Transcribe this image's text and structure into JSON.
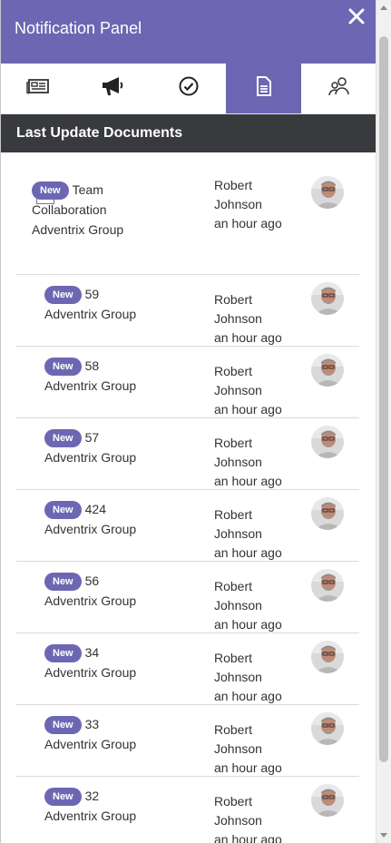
{
  "header": {
    "title": "Notification Panel",
    "close_icon": "close-icon"
  },
  "tabs": [
    {
      "name": "news",
      "icon": "newspaper-icon",
      "active": false
    },
    {
      "name": "announcements",
      "icon": "megaphone-icon",
      "active": false
    },
    {
      "name": "tasks",
      "icon": "checkmark-circle-icon",
      "active": false
    },
    {
      "name": "documents",
      "icon": "document-icon",
      "active": true
    },
    {
      "name": "people",
      "icon": "users-icon",
      "active": false
    }
  ],
  "section": {
    "title": "Last Update Documents"
  },
  "colors": {
    "accent": "#6c67b3",
    "section_bar": "#383a3d"
  },
  "items": [
    {
      "badge": "New",
      "title": "Team Collaboration",
      "group": "Adventrix Group",
      "author_first": "Robert",
      "author_last": "Johnson",
      "time": "an hour ago"
    },
    {
      "badge": "New",
      "title": "59",
      "group": "Adventrix Group",
      "author_first": "Robert",
      "author_last": "Johnson",
      "time": "an hour ago"
    },
    {
      "badge": "New",
      "title": "58",
      "group": "Adventrix Group",
      "author_first": "Robert",
      "author_last": "Johnson",
      "time": "an hour ago"
    },
    {
      "badge": "New",
      "title": "57",
      "group": "Adventrix Group",
      "author_first": "Robert",
      "author_last": "Johnson",
      "time": "an hour ago"
    },
    {
      "badge": "New",
      "title": "424",
      "group": "Adventrix Group",
      "author_first": "Robert",
      "author_last": "Johnson",
      "time": "an hour ago"
    },
    {
      "badge": "New",
      "title": "56",
      "group": "Adventrix Group",
      "author_first": "Robert",
      "author_last": "Johnson",
      "time": "an hour ago"
    },
    {
      "badge": "New",
      "title": "34",
      "group": "Adventrix Group",
      "author_first": "Robert",
      "author_last": "Johnson",
      "time": "an hour ago"
    },
    {
      "badge": "New",
      "title": "33",
      "group": "Adventrix Group",
      "author_first": "Robert",
      "author_last": "Johnson",
      "time": "an hour ago"
    },
    {
      "badge": "New",
      "title": "32",
      "group": "Adventrix Group",
      "author_first": "Robert",
      "author_last": "Johnson",
      "time": "an hour ago"
    }
  ]
}
